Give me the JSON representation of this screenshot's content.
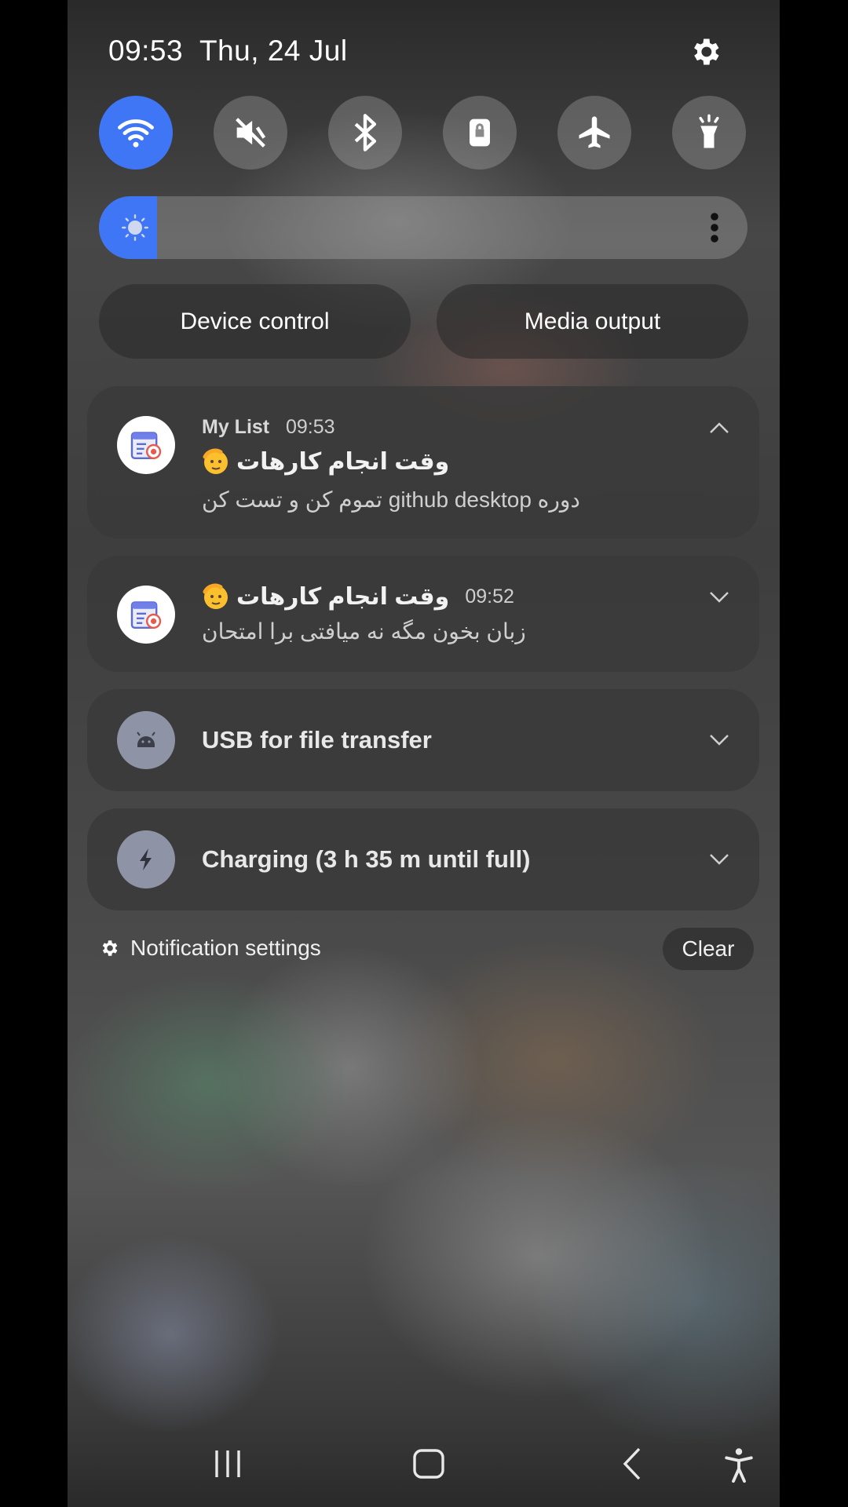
{
  "status": {
    "time": "09:53",
    "date": "Thu, 24 Jul"
  },
  "quick_settings": [
    {
      "name": "wifi-toggle",
      "icon": "wifi-icon",
      "active": true
    },
    {
      "name": "sound-toggle",
      "icon": "mute-icon",
      "active": false
    },
    {
      "name": "bluetooth-toggle",
      "icon": "bluetooth-icon",
      "active": false
    },
    {
      "name": "rotation-lock-toggle",
      "icon": "lock-rotation-icon",
      "active": false
    },
    {
      "name": "airplane-toggle",
      "icon": "airplane-icon",
      "active": false
    },
    {
      "name": "flashlight-toggle",
      "icon": "flashlight-icon",
      "active": false
    }
  ],
  "brightness": {
    "level": 0.09
  },
  "buttons": {
    "device_control": "Device control",
    "media_output": "Media output"
  },
  "notifications": {
    "first": {
      "app": "My List",
      "time": "09:53",
      "title": "وقت انجام کارهات",
      "body": "دوره github desktop تموم کن و تست کن",
      "expanded": true
    },
    "second": {
      "time": "09:52",
      "title": "وقت انجام کارهات",
      "body": "زبان بخون مگه نه میافتی برا امتحان",
      "expanded": false
    },
    "usb": {
      "title": "USB for file transfer"
    },
    "charging": {
      "title": "Charging (3 h 35 m until full)"
    }
  },
  "footer": {
    "settings_label": "Notification settings",
    "clear_label": "Clear"
  },
  "colors": {
    "accent": "#3f76f5",
    "card": "#3a3a3a"
  }
}
